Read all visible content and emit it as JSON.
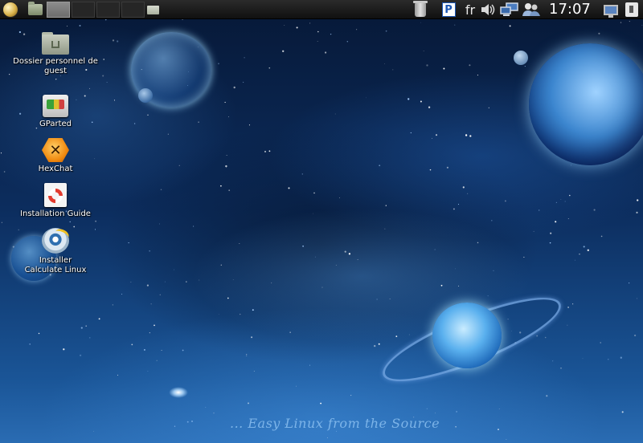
{
  "panel": {
    "clock": "17:07",
    "keyboard_layout": "fr",
    "icons": {
      "menu": "menu-orb-icon",
      "home": "home-folder-icon",
      "folder": "folder-icon",
      "trash": "trash-icon",
      "package": "package-updater-icon",
      "volume": "volume-icon",
      "network": "network-icon",
      "users": "users-icon",
      "monitor": "display-icon",
      "power": "power-icon"
    }
  },
  "desktop": {
    "icons": [
      {
        "label": "Dossier personnel de guest",
        "icon": "home-folder-icon"
      },
      {
        "label": "GParted",
        "icon": "gparted-icon"
      },
      {
        "label": "HexChat",
        "icon": "hexchat-icon"
      },
      {
        "label": "Installation Guide",
        "icon": "installation-guide-icon"
      },
      {
        "label": "Installer Calculate Linux",
        "icon": "installer-icon"
      }
    ]
  },
  "wallpaper": {
    "slogan": "... Easy Linux from the Source",
    "colors": {
      "deep": "#071a3a",
      "mid": "#0c2d5e",
      "glow": "#2a6cb3"
    }
  }
}
